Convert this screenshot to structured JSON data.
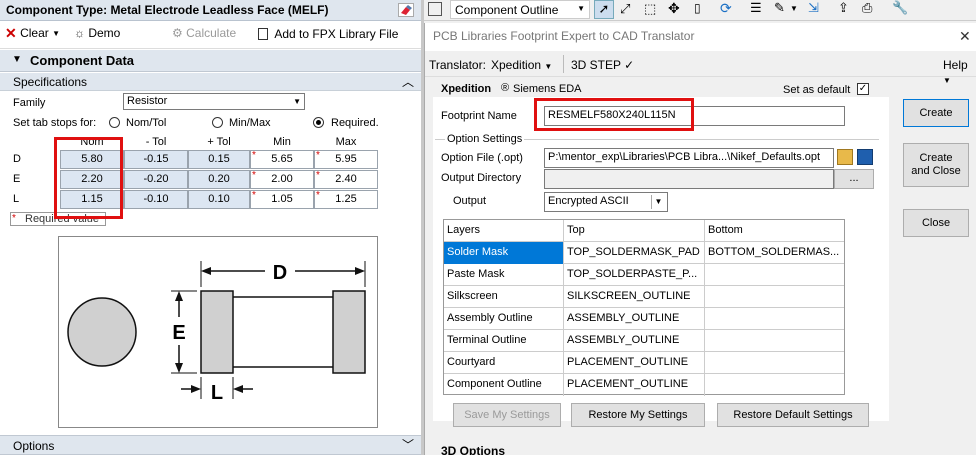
{
  "left": {
    "title": "Component Type: Metal Electrode Leadless Face (MELF)",
    "toolbar": {
      "clear": "Clear",
      "demo": "Demo",
      "calculate": "Calculate",
      "add": "Add to FPX Library File"
    },
    "component_data": "Component Data",
    "specifications": "Specifications",
    "family_label": "Family",
    "family_value": "Resistor",
    "tabstops_label": "Set tab stops for:",
    "radio_nomtol": "Nom/Tol",
    "radio_minmax": "Min/Max",
    "radio_required": "Required.",
    "headers": [
      "Nom",
      "- Tol",
      "+ Tol",
      "Min",
      "Max"
    ],
    "rows": [
      {
        "label": "D",
        "nom": "5.80",
        "mtol": "-0.15",
        "ptol": "0.15",
        "min": "5.65",
        "max": "5.95"
      },
      {
        "label": "E",
        "nom": "2.20",
        "mtol": "-0.20",
        "ptol": "0.20",
        "min": "2.00",
        "max": "2.40"
      },
      {
        "label": "L",
        "nom": "1.15",
        "mtol": "-0.10",
        "ptol": "0.10",
        "min": "1.05",
        "max": "1.25"
      }
    ],
    "required_value": "Required value",
    "diagram": {
      "d": "D",
      "e": "E",
      "l": "L"
    },
    "options": "Options"
  },
  "right_toolbar": {
    "view": "Component Outline"
  },
  "dialog": {
    "title": "PCB Libraries Footprint Expert to CAD Translator",
    "menu": {
      "translator_label": "Translator:",
      "translator_value": "Xpedition",
      "step": "3D STEP",
      "help": "Help"
    },
    "brand": "Xpedition",
    "brand_sub": "Siemens EDA",
    "set_default": "Set as default",
    "footprint_label": "Footprint Name",
    "footprint_value": "RESMELF580X240L115N",
    "option_settings": "Option Settings",
    "option_file_label": "Option File (.opt)",
    "option_file_value": "P:\\mentor_exp\\Libraries\\PCB Libra...\\Nikef_Defaults.opt",
    "output_dir_label": "Output Directory",
    "browse": "...",
    "output_label": "Output",
    "output_value": "Encrypted ASCII",
    "grid_headers": [
      "Layers",
      "Top",
      "Bottom"
    ],
    "grid_rows": [
      {
        "layer": "Solder Mask",
        "top": "TOP_SOLDERMASK_PAD",
        "bottom": "BOTTOM_SOLDERMAS..."
      },
      {
        "layer": "Paste Mask",
        "top": "TOP_SOLDERPASTE_P...",
        "bottom": ""
      },
      {
        "layer": "Silkscreen",
        "top": "SILKSCREEN_OUTLINE",
        "bottom": ""
      },
      {
        "layer": "Assembly Outline",
        "top": "ASSEMBLY_OUTLINE",
        "bottom": ""
      },
      {
        "layer": "Terminal Outline",
        "top": "ASSEMBLY_OUTLINE",
        "bottom": ""
      },
      {
        "layer": "Courtyard",
        "top": "PLACEMENT_OUTLINE",
        "bottom": ""
      },
      {
        "layer": "Component Outline",
        "top": "PLACEMENT_OUTLINE",
        "bottom": ""
      }
    ],
    "save_settings": "Save My Settings",
    "restore_settings": "Restore My Settings",
    "restore_defaults": "Restore Default Settings",
    "create": "Create",
    "create_close_1": "Create",
    "create_close_2": "and Close",
    "close": "Close",
    "options_3d": "3D Options"
  },
  "colors": {
    "accent": "#0078d7",
    "highlight": "#e01010",
    "cell_blue": "#dce6f2",
    "panel_header": "#dfe6ee"
  }
}
